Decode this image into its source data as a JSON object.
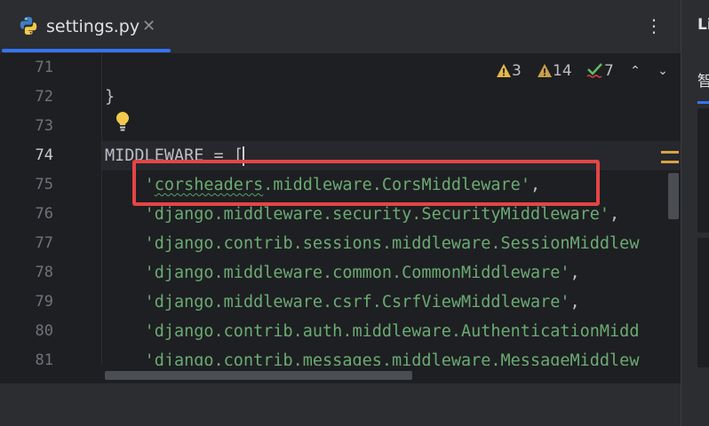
{
  "tab": {
    "file_name": "settings.py",
    "close_glyph": "✕"
  },
  "toolbar": {
    "more_glyph": "⋮"
  },
  "inspections": {
    "warnings_a": "3",
    "warnings_b": "14",
    "ok": "7",
    "prev_glyph": "⌃",
    "next_glyph": "⌄"
  },
  "editor": {
    "line_numbers": [
      "71",
      "72",
      "73",
      "74",
      "75",
      "76",
      "77",
      "78",
      "79",
      "80",
      "81"
    ],
    "current_line": "74",
    "lines": {
      "l72": "}",
      "l74": "MIDDLEWARE = [",
      "l75_q1": "'",
      "l75_word": "corsheaders",
      "l75_rest": ".middleware.CorsMiddleware'",
      "l75_comma": ",",
      "l76_str": "'django.middleware.security.SecurityMiddleware'",
      "l76_comma": ",",
      "l77_str": "'django.contrib.sessions.middleware.SessionMiddlew",
      "l78_str": "'django.middleware.common.CommonMiddleware'",
      "l78_comma": ",",
      "l79_str": "'django.middleware.csrf.CsrfViewMiddleware'",
      "l79_comma": ",",
      "l80_str": "'django.contrib.auth.middleware.AuthenticationMidd",
      "l81_str": "'django.contrib.messages.middleware.MessageMiddlew"
    }
  },
  "right_panel": {
    "title": "Li",
    "tab": "智"
  },
  "colors": {
    "accent": "#3574f0",
    "string": "#6aab73",
    "warning": "#e6b84a",
    "ok_check": "#5fb865",
    "highlight_box": "#e54545"
  }
}
